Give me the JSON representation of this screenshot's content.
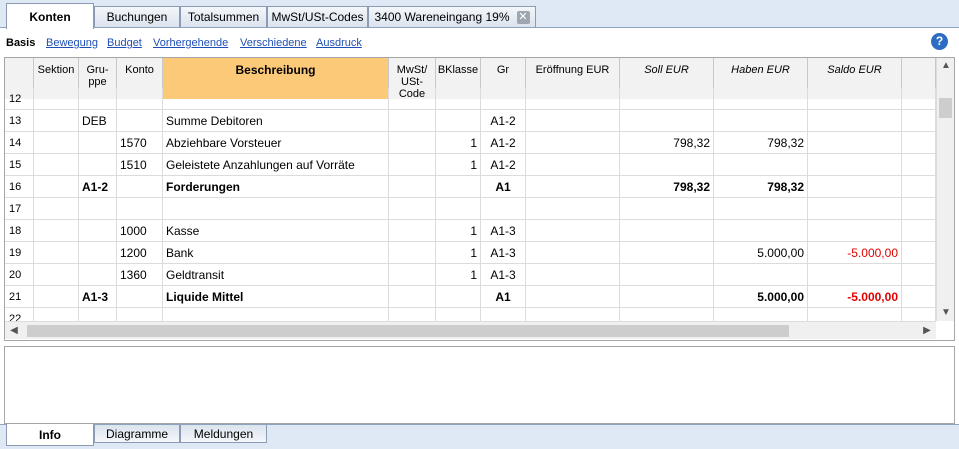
{
  "tabs": [
    {
      "label": "Konten",
      "active": true
    },
    {
      "label": "Buchungen"
    },
    {
      "label": "Totalsummen"
    },
    {
      "label": "MwSt/USt-Codes"
    },
    {
      "label": "3400 Wareneingang 19%",
      "close_icon": "close-icon"
    }
  ],
  "views": {
    "basis": "Basis",
    "links": [
      "Bewegung",
      "Budget",
      "Vorhergehende",
      "Verschiedene",
      "Ausdruck"
    ],
    "help": "?"
  },
  "columns": {
    "sektion": "Sektion",
    "gruppe": "Gru-\nppe",
    "konto": "Konto",
    "beschreibung": "Beschreibung",
    "mwst": "MwSt/\nUSt-\nCode",
    "bklasse": "BKlasse",
    "gr": "Gr",
    "eroeffnung": "Eröffnung EUR",
    "soll": "Soll EUR",
    "haben": "Haben EUR",
    "saldo": "Saldo EUR"
  },
  "rows": [
    {
      "num": "12",
      "sektion": "",
      "gruppe": "",
      "konto": "",
      "beschreibung": "",
      "mwst": "",
      "bklasse": "",
      "gr": "",
      "eroeffnung": "",
      "soll": "",
      "haben": "",
      "saldo": ""
    },
    {
      "num": "13",
      "sektion": "",
      "gruppe": "DEB",
      "konto": "",
      "beschreibung": "Summe Debitoren",
      "mwst": "",
      "bklasse": "",
      "gr": "A1-2",
      "eroeffnung": "",
      "soll": "",
      "haben": "",
      "saldo": ""
    },
    {
      "num": "14",
      "sektion": "",
      "gruppe": "",
      "konto": "1570",
      "beschreibung": "Abziehbare Vorsteuer",
      "mwst": "",
      "bklasse": "1",
      "gr": "A1-2",
      "eroeffnung": "",
      "soll": "798,32",
      "haben": "798,32",
      "saldo": ""
    },
    {
      "num": "15",
      "sektion": "",
      "gruppe": "",
      "konto": "1510",
      "beschreibung": "Geleistete Anzahlungen auf Vorräte",
      "mwst": "",
      "bklasse": "1",
      "gr": "A1-2",
      "eroeffnung": "",
      "soll": "",
      "haben": "",
      "saldo": ""
    },
    {
      "num": "16",
      "sektion": "",
      "gruppe": "A1-2",
      "konto": "",
      "beschreibung": "Forderungen",
      "mwst": "",
      "bklasse": "",
      "gr": "A1",
      "eroeffnung": "",
      "soll": "798,32",
      "haben": "798,32",
      "saldo": "",
      "bold": true
    },
    {
      "num": "17",
      "sektion": "",
      "gruppe": "",
      "konto": "",
      "beschreibung": "",
      "mwst": "",
      "bklasse": "",
      "gr": "",
      "eroeffnung": "",
      "soll": "",
      "haben": "",
      "saldo": ""
    },
    {
      "num": "18",
      "sektion": "",
      "gruppe": "",
      "konto": "1000",
      "beschreibung": "Kasse",
      "mwst": "",
      "bklasse": "1",
      "gr": "A1-3",
      "eroeffnung": "",
      "soll": "",
      "haben": "",
      "saldo": ""
    },
    {
      "num": "19",
      "sektion": "",
      "gruppe": "",
      "konto": "1200",
      "beschreibung": "Bank",
      "mwst": "",
      "bklasse": "1",
      "gr": "A1-3",
      "eroeffnung": "",
      "soll": "",
      "haben": "5.000,00",
      "saldo": "-5.000,00"
    },
    {
      "num": "20",
      "sektion": "",
      "gruppe": "",
      "konto": "1360",
      "beschreibung": "Geldtransit",
      "mwst": "",
      "bklasse": "1",
      "gr": "A1-3",
      "eroeffnung": "",
      "soll": "",
      "haben": "",
      "saldo": ""
    },
    {
      "num": "21",
      "sektion": "",
      "gruppe": "A1-3",
      "konto": "",
      "beschreibung": "Liquide Mittel",
      "mwst": "",
      "bklasse": "",
      "gr": "A1",
      "eroeffnung": "",
      "soll": "",
      "haben": "5.000,00",
      "saldo": "-5.000,00",
      "bold": true
    },
    {
      "num": "22",
      "sektion": "",
      "gruppe": "",
      "konto": "",
      "beschreibung": "",
      "mwst": "",
      "bklasse": "",
      "gr": "",
      "eroeffnung": "",
      "soll": "",
      "haben": "",
      "saldo": ""
    }
  ],
  "scroll": {
    "up": "▲",
    "down": "▼",
    "left": "◀",
    "right": "▶"
  },
  "bottom_tabs": [
    {
      "label": "Info",
      "active": true
    },
    {
      "label": "Diagramme"
    },
    {
      "label": "Meldungen"
    }
  ],
  "colors": {
    "selected_header": "#fcc978",
    "negative": "#e00000",
    "link": "#1f4fb5",
    "tab_bar": "#dfe9f5"
  }
}
